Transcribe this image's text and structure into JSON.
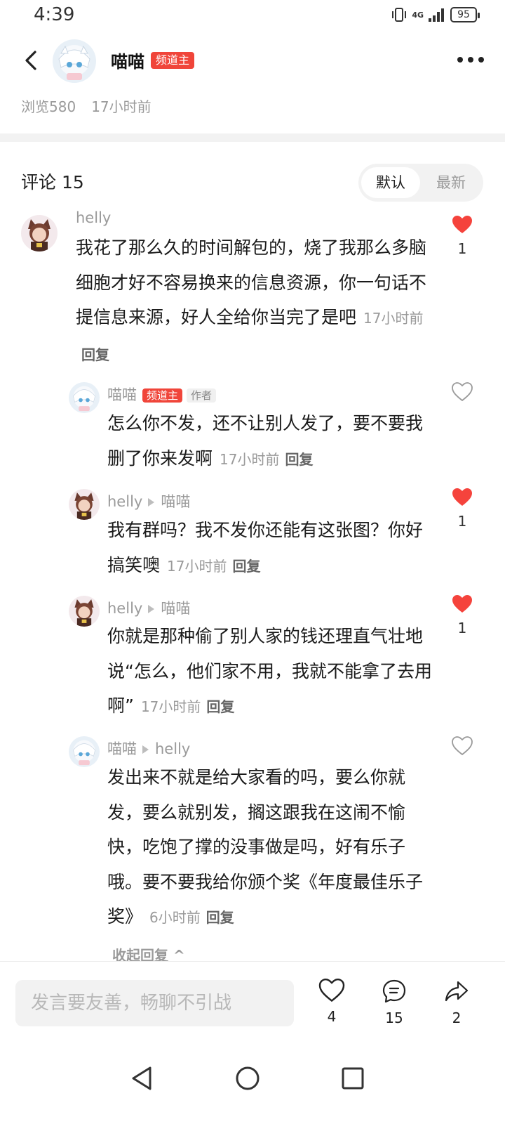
{
  "status_bar": {
    "time": "4:39",
    "network": "4G",
    "battery": "95"
  },
  "header": {
    "author": "喵喵",
    "badge": "频道主"
  },
  "meta": {
    "views": "浏览580",
    "posted": "17小时前"
  },
  "comments_header": {
    "title": "评论 15",
    "sort_default": "默认",
    "sort_latest": "最新"
  },
  "comments": [
    {
      "user": "helly",
      "text": "我花了那么久的时间解包的，烧了我那么多脑细胞才好不容易换来的信息资源，你一句话不提信息来源，好人全给你当完了是吧",
      "time": "17小时前",
      "reply": "回复",
      "likes": "1",
      "liked": true
    },
    {
      "user": "喵喵",
      "badge": "频道主",
      "author_tag": "作者",
      "text": "怎么你不发，还不让别人发了，要不要我删了你来发啊",
      "time": "17小时前",
      "reply": "回复",
      "liked": false
    },
    {
      "user": "helly",
      "reply_to": "喵喵",
      "text": "我有群吗？我不发你还能有这张图？你好搞笑噢",
      "time": "17小时前",
      "reply": "回复",
      "likes": "1",
      "liked": true
    },
    {
      "user": "helly",
      "reply_to": "喵喵",
      "text": "你就是那种偷了别人家的钱还理直气壮地说“怎么，他们家不用，我就不能拿了去用啊”",
      "time": "17小时前",
      "reply": "回复",
      "likes": "1",
      "liked": true
    },
    {
      "user": "喵喵",
      "reply_to": "helly",
      "text": "发出来不就是给大家看的吗，要么你就发，要么就别发，搁这跟我在这闹不愉快，吃饱了撑的没事做是吗，好有乐子哦。要不要我给你颁个奖《年度最佳乐子奖》",
      "time": "6小时前",
      "reply": "回复",
      "liked": false
    }
  ],
  "collapse_label": "收起回复 ^",
  "bottom_bar": {
    "input_placeholder": "发言要友善，畅聊不引战",
    "likes": "4",
    "comments": "15",
    "shares": "2"
  },
  "colors": {
    "accent_red": "#f0453a",
    "like_red": "#f5433c"
  }
}
